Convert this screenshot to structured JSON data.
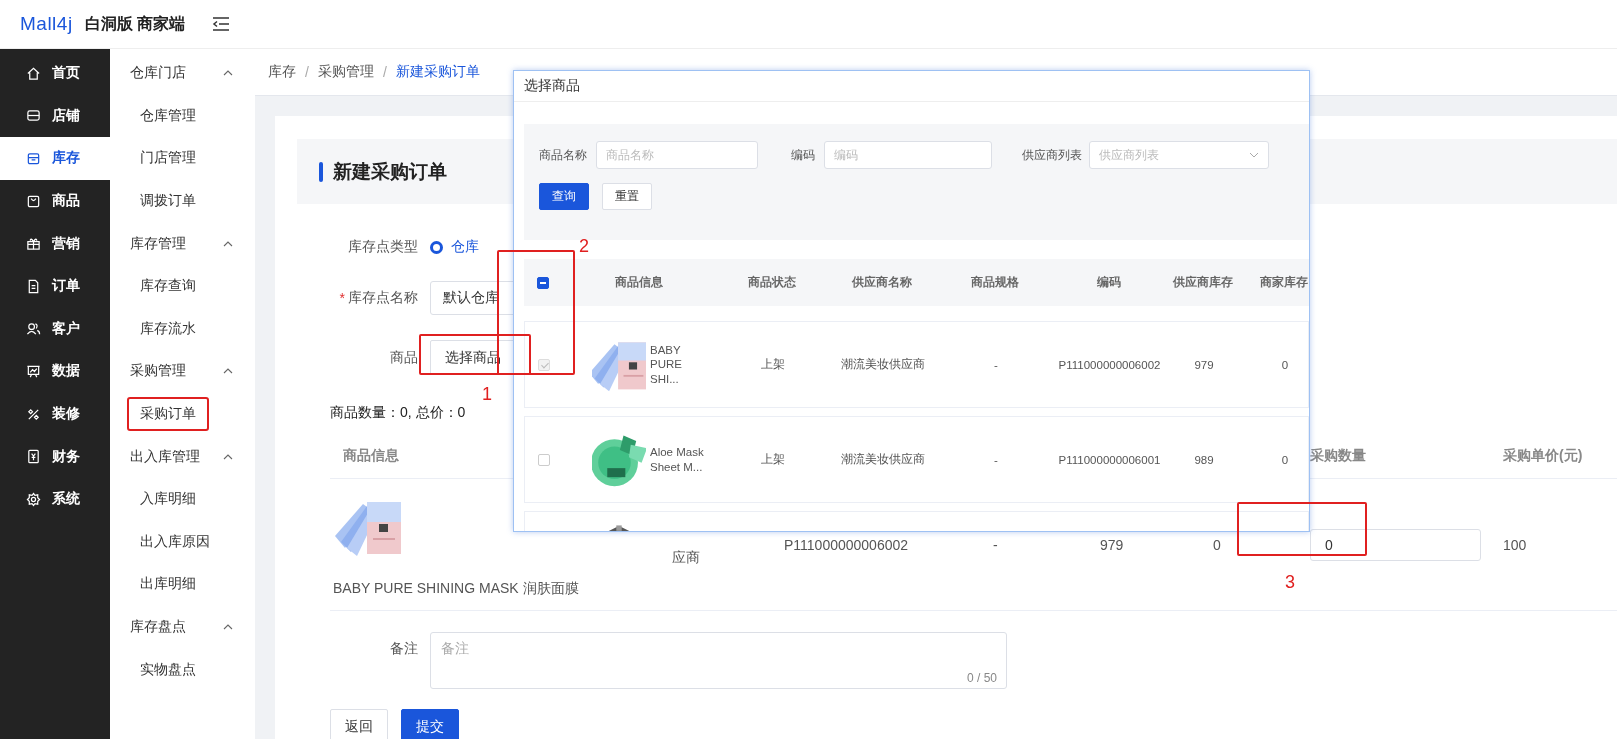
{
  "header": {
    "logo": "Mall4j",
    "title": "白洞版 商家端"
  },
  "sidebar": {
    "items": [
      {
        "label": "首页",
        "selected": false
      },
      {
        "label": "店铺",
        "selected": false
      },
      {
        "label": "库存",
        "selected": true
      },
      {
        "label": "商品",
        "selected": false
      },
      {
        "label": "营销",
        "selected": false
      },
      {
        "label": "订单",
        "selected": false
      },
      {
        "label": "客户",
        "selected": false
      },
      {
        "label": "数据",
        "selected": false
      },
      {
        "label": "装修",
        "selected": false
      },
      {
        "label": "财务",
        "selected": false
      },
      {
        "label": "系统",
        "selected": false
      }
    ]
  },
  "submenu": {
    "groups": [
      {
        "title": "仓库门店",
        "expanded": true,
        "items": [
          {
            "label": "仓库管理",
            "selected": false,
            "highlighted": false
          },
          {
            "label": "门店管理",
            "selected": false,
            "highlighted": false
          },
          {
            "label": "调拨订单",
            "selected": false,
            "highlighted": false
          }
        ]
      },
      {
        "title": "库存管理",
        "expanded": true,
        "items": [
          {
            "label": "库存查询",
            "selected": false,
            "highlighted": false
          },
          {
            "label": "库存流水",
            "selected": false,
            "highlighted": false
          }
        ]
      },
      {
        "title": "采购管理",
        "expanded": true,
        "items": [
          {
            "label": "采购订单",
            "selected": false,
            "highlighted": true
          }
        ]
      },
      {
        "title": "出入库管理",
        "expanded": true,
        "items": [
          {
            "label": "入库明细",
            "selected": false,
            "highlighted": false
          },
          {
            "label": "出入库原因",
            "selected": false,
            "highlighted": false
          },
          {
            "label": "出库明细",
            "selected": false,
            "highlighted": false
          }
        ]
      },
      {
        "title": "库存盘点",
        "expanded": true,
        "items": [
          {
            "label": "实物盘点",
            "selected": false,
            "highlighted": false
          }
        ]
      }
    ]
  },
  "breadcrumb": [
    {
      "label": "库存",
      "current": false,
      "separator": "/"
    },
    {
      "label": "采购管理",
      "current": false,
      "separator": "/"
    },
    {
      "label": "新建采购订单",
      "current": true
    }
  ],
  "page_title": "新建采购订单",
  "form": {
    "location_type": {
      "label": "库存点类型",
      "options": [
        {
          "label": "仓库",
          "selected": true
        }
      ]
    },
    "location_name": {
      "label": "库存点名称",
      "required_mark": "*",
      "value": "默认仓库"
    },
    "product": {
      "label": "商品",
      "button": "选择商品"
    },
    "summary": "商品数量：0, 总价：0",
    "table": {
      "headers": {
        "product": "商品信息",
        "quantity": "采购数量",
        "unit_price": "采购单价(元)"
      },
      "rows": [
        {
          "kind": "picture",
          "name": "BABY PURE SHINING MASK 润肤面膜",
          "supplier": "应商",
          "code": "P111000000006002",
          "spec": "-",
          "supplier_stock": "979",
          "merchant_stock": "0",
          "quantity": "0",
          "unit_price": "100"
        }
      ]
    },
    "remark": {
      "label": "备注",
      "placeholder": "备注",
      "counter": "0 / 50"
    },
    "buttons": [
      {
        "label": "返回",
        "kind": "default"
      },
      {
        "label": "提交",
        "kind": "primary"
      }
    ]
  },
  "dialog": {
    "title": "选择商品",
    "filters": [
      {
        "label": "商品名称",
        "placeholder": "商品名称",
        "kind": "input"
      },
      {
        "label": "编码",
        "placeholder": "编码",
        "kind": "input"
      },
      {
        "label": "供应商列表",
        "placeholder": "供应商列表",
        "kind": "select"
      }
    ],
    "buttons": [
      {
        "label": "查询",
        "kind": "primary"
      },
      {
        "label": "重置",
        "kind": "default"
      }
    ],
    "table": {
      "select_all": {
        "indeterminate": true
      },
      "columns": [
        "商品信息",
        "商品状态",
        "供应商名称",
        "商品规格",
        "编码",
        "供应商库存",
        "商家库存"
      ],
      "rows": [
        {
          "kind": "full",
          "checked": true,
          "disabled": true,
          "name": "BABY PURE SHI...",
          "status": "上架",
          "supplier": "潮流美妆供应商",
          "spec": "-",
          "code": "P111000000006002",
          "supplier_stock": "979",
          "merchant_stock": "0"
        },
        {
          "kind": "full",
          "checked": false,
          "disabled": false,
          "name": "Aloe Mask Sheet M...",
          "status": "上架",
          "supplier": "潮流美妆供应商",
          "spec": "-",
          "code": "P111000000006001",
          "supplier_stock": "989",
          "merchant_stock": "0"
        },
        {
          "kind": "clipped"
        }
      ]
    }
  },
  "annotations": [
    {
      "number": "1"
    },
    {
      "number": "2"
    },
    {
      "number": "3"
    }
  ]
}
